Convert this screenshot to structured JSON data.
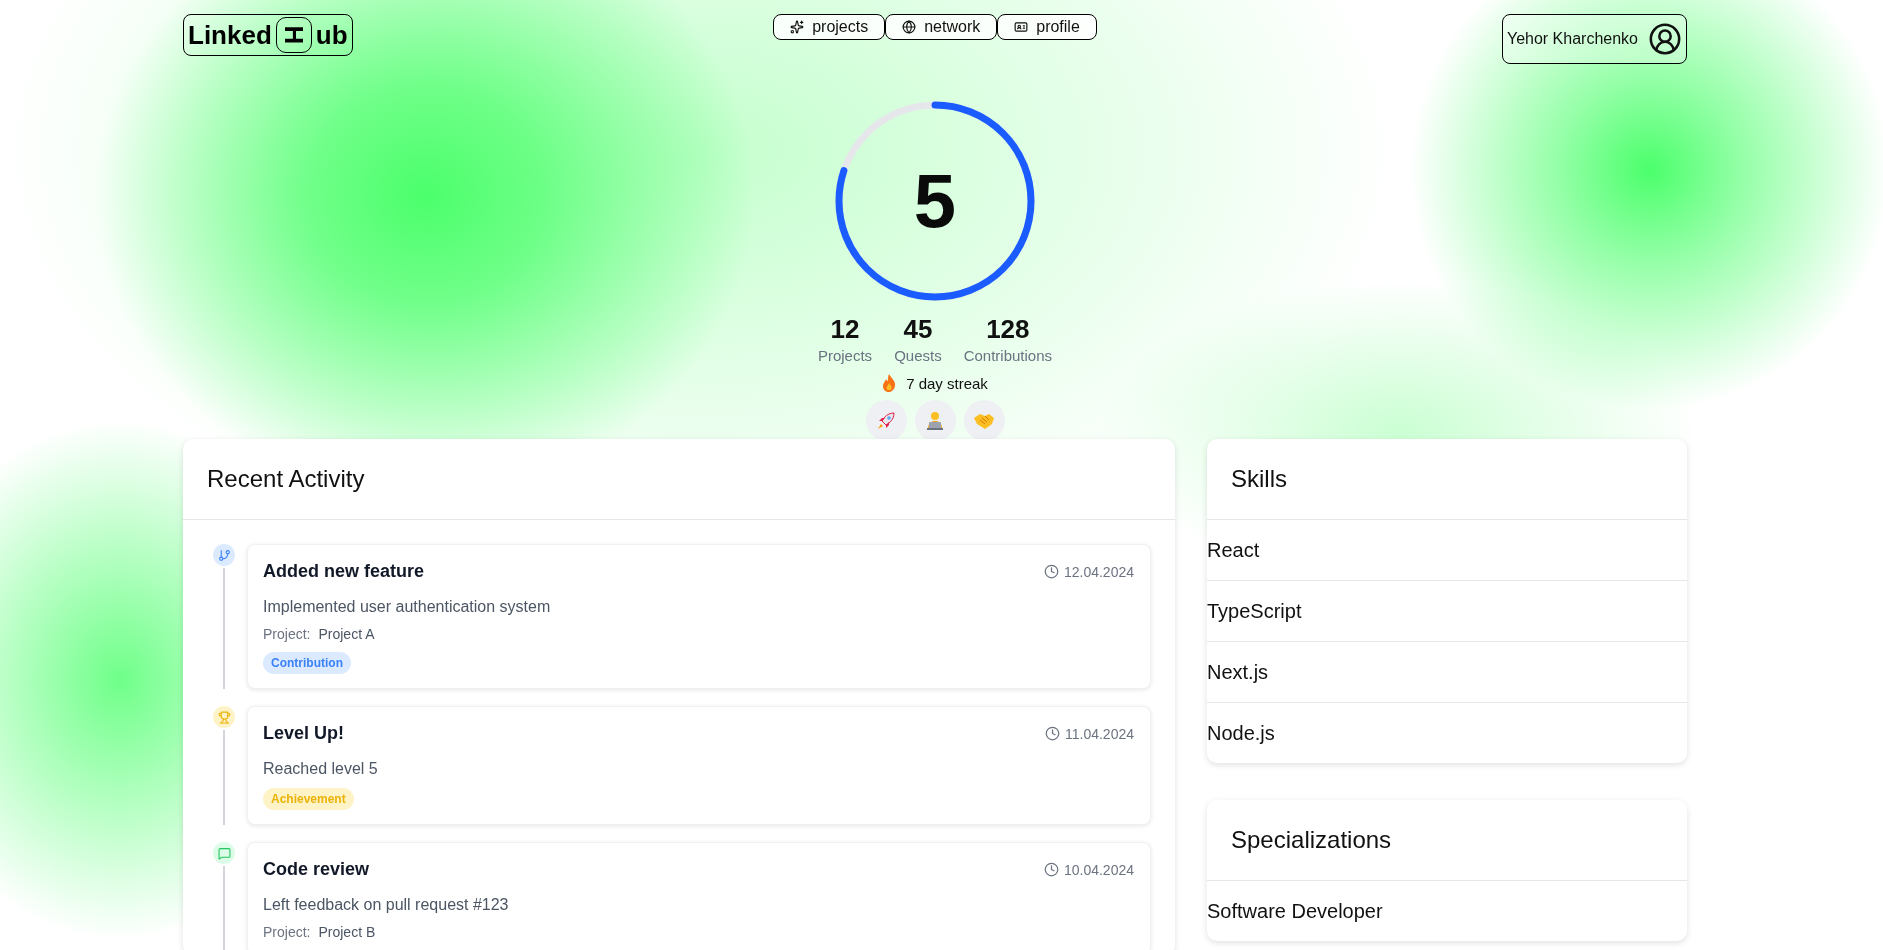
{
  "logo": {
    "prefix": "Linked",
    "mark": "H",
    "suffix": "ub"
  },
  "nav": [
    {
      "label": "projects"
    },
    {
      "label": "network"
    },
    {
      "label": "profile"
    }
  ],
  "user": {
    "name": "Yehor Kharchenko"
  },
  "level": {
    "value": "5",
    "level": 0.8
  },
  "stats": [
    {
      "value": "12",
      "label": "Projects"
    },
    {
      "value": "45",
      "label": "Quests"
    },
    {
      "value": "128",
      "label": "Contributions"
    }
  ],
  "streak": "7 day streak",
  "activity": {
    "title": "Recent Activity",
    "items": [
      {
        "kind": "contribution",
        "title": "Added new feature",
        "date": "12.04.2024",
        "description": "Implemented user authentication system",
        "project_label": "Project:",
        "project": "Project A",
        "tag": "Contribution"
      },
      {
        "kind": "achievement",
        "title": "Level Up!",
        "date": "11.04.2024",
        "description": "Reached level 5",
        "tag": "Achievement"
      },
      {
        "kind": "review",
        "title": "Code review",
        "date": "10.04.2024",
        "description": "Left feedback on pull request #123",
        "project_label": "Project:",
        "project": "Project B"
      }
    ]
  },
  "skills": {
    "title": "Skills",
    "items": [
      "React",
      "TypeScript",
      "Next.js",
      "Node.js"
    ]
  },
  "specializations": {
    "title": "Specializations",
    "items": [
      "Software Developer"
    ]
  }
}
